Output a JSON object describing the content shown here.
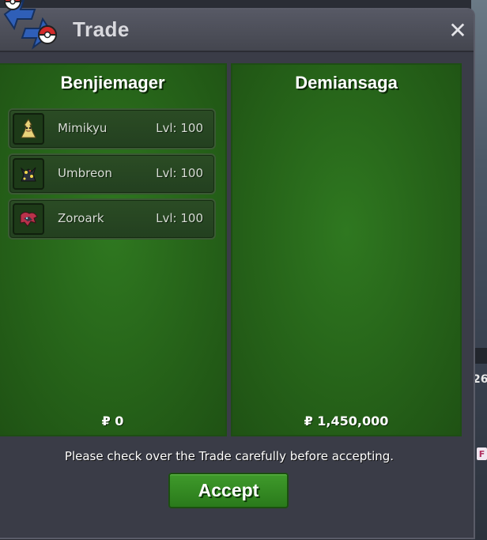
{
  "window": {
    "title": "Trade",
    "close_label": "✕"
  },
  "background": {
    "partial_text": "26",
    "badge_letter": "F"
  },
  "left_panel": {
    "trainer": "Benjiemager",
    "money": "₽ 0",
    "pokemon": [
      {
        "name": "Mimikyu",
        "level": "Lvl: 100",
        "icon": "mimikyu-sprite-icon"
      },
      {
        "name": "Umbreon",
        "level": "Lvl: 100",
        "icon": "umbreon-sprite-icon"
      },
      {
        "name": "Zoroark",
        "level": "Lvl: 100",
        "icon": "zoroark-sprite-icon"
      }
    ]
  },
  "right_panel": {
    "trainer": "Demiansaga",
    "money": "₽ 1,450,000",
    "pokemon": []
  },
  "footer": {
    "notice": "Please check over the Trade carefully before accepting.",
    "accept_label": "Accept"
  },
  "colors": {
    "panel_green": "#266319",
    "accept_green": "#2a7a1b",
    "window_bg": "#3a3c47"
  }
}
